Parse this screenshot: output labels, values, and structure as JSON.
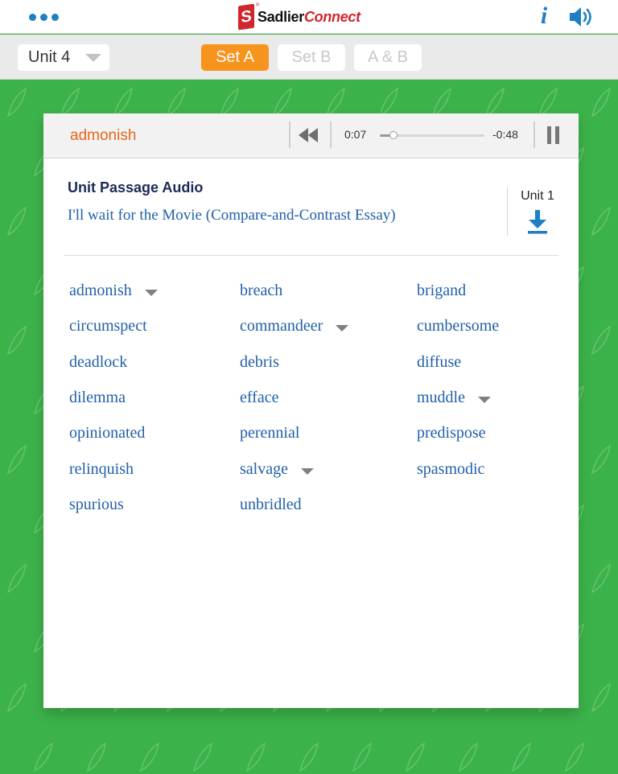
{
  "header": {
    "logo_main": "Sadlier",
    "logo_accent": "Connect",
    "logo_mark": "S",
    "logo_registered": "®",
    "info_label": "i"
  },
  "toolbar": {
    "unit_select": "Unit 4",
    "set_a": "Set A",
    "set_b": "Set B",
    "set_ab": "A & B",
    "active_set": "Set A"
  },
  "player": {
    "current_word": "admonish",
    "elapsed": "0:07",
    "remaining": "-0:48",
    "progress": 0.13
  },
  "passage": {
    "heading": "Unit Passage Audio",
    "title": "I'll wait for the Movie (Compare-and-Contrast Essay)",
    "download_label": "Unit 1"
  },
  "words": [
    {
      "text": "admonish",
      "has_dropdown": true
    },
    {
      "text": "breach",
      "has_dropdown": false
    },
    {
      "text": "brigand",
      "has_dropdown": false
    },
    {
      "text": "circumspect",
      "has_dropdown": false
    },
    {
      "text": "commandeer",
      "has_dropdown": true
    },
    {
      "text": "cumbersome",
      "has_dropdown": false
    },
    {
      "text": "deadlock",
      "has_dropdown": false
    },
    {
      "text": "debris",
      "has_dropdown": false
    },
    {
      "text": "diffuse",
      "has_dropdown": false
    },
    {
      "text": "dilemma",
      "has_dropdown": false
    },
    {
      "text": "efface",
      "has_dropdown": false
    },
    {
      "text": "muddle",
      "has_dropdown": true
    },
    {
      "text": "opinionated",
      "has_dropdown": false
    },
    {
      "text": "perennial",
      "has_dropdown": false
    },
    {
      "text": "predispose",
      "has_dropdown": false
    },
    {
      "text": "relinquish",
      "has_dropdown": false
    },
    {
      "text": "salvage",
      "has_dropdown": true
    },
    {
      "text": "spasmodic",
      "has_dropdown": false
    },
    {
      "text": "spurious",
      "has_dropdown": false
    },
    {
      "text": "unbridled",
      "has_dropdown": false
    }
  ],
  "colors": {
    "background_green": "#3cb24a",
    "accent_orange": "#f7941d",
    "link_blue": "#2260a8",
    "brand_red": "#d0262d"
  }
}
